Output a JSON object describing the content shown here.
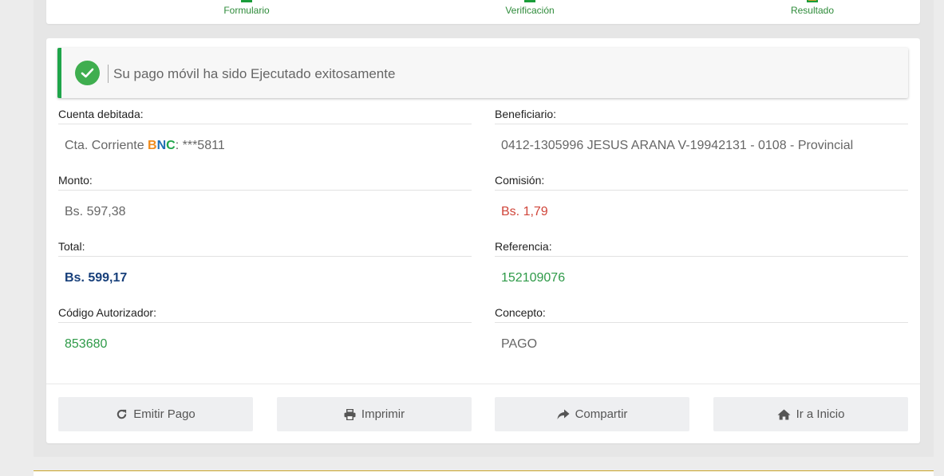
{
  "steps": [
    {
      "label": "Formulario"
    },
    {
      "label": "Verificación"
    },
    {
      "label": "Resultado"
    }
  ],
  "alert": {
    "message": "Su pago móvil ha sido Ejecutado exitosamente",
    "icon": "check-circle-icon",
    "color": "#1fa54a"
  },
  "fields": {
    "cuenta": {
      "label": "Cuenta debitada:",
      "prefix": "Cta. Corriente ",
      "bank_b": "B",
      "bank_n": "N",
      "bank_c": "C",
      "suffix": ": ***5811"
    },
    "beneficiario": {
      "label": "Beneficiario:",
      "value": "0412-1305996 JESUS ARANA V-19942131 - 0108 - Provincial"
    },
    "monto": {
      "label": "Monto:",
      "value": "Bs. 597,38"
    },
    "comision": {
      "label": "Comisión:",
      "value": "Bs. 1,79"
    },
    "total": {
      "label": "Total:",
      "value": "Bs. 599,17"
    },
    "referencia": {
      "label": "Referencia:",
      "value": "152109076"
    },
    "codigo": {
      "label": "Código Autorizador:",
      "value": "853680"
    },
    "concepto": {
      "label": "Concepto:",
      "value": "PAGO"
    }
  },
  "buttons": {
    "emitir": {
      "label": "Emitir Pago",
      "icon": "redo-icon"
    },
    "imprimir": {
      "label": "Imprimir",
      "icon": "print-icon"
    },
    "compartir": {
      "label": "Compartir",
      "icon": "share-icon"
    },
    "inicio": {
      "label": "Ir a Inicio",
      "icon": "home-icon"
    }
  }
}
